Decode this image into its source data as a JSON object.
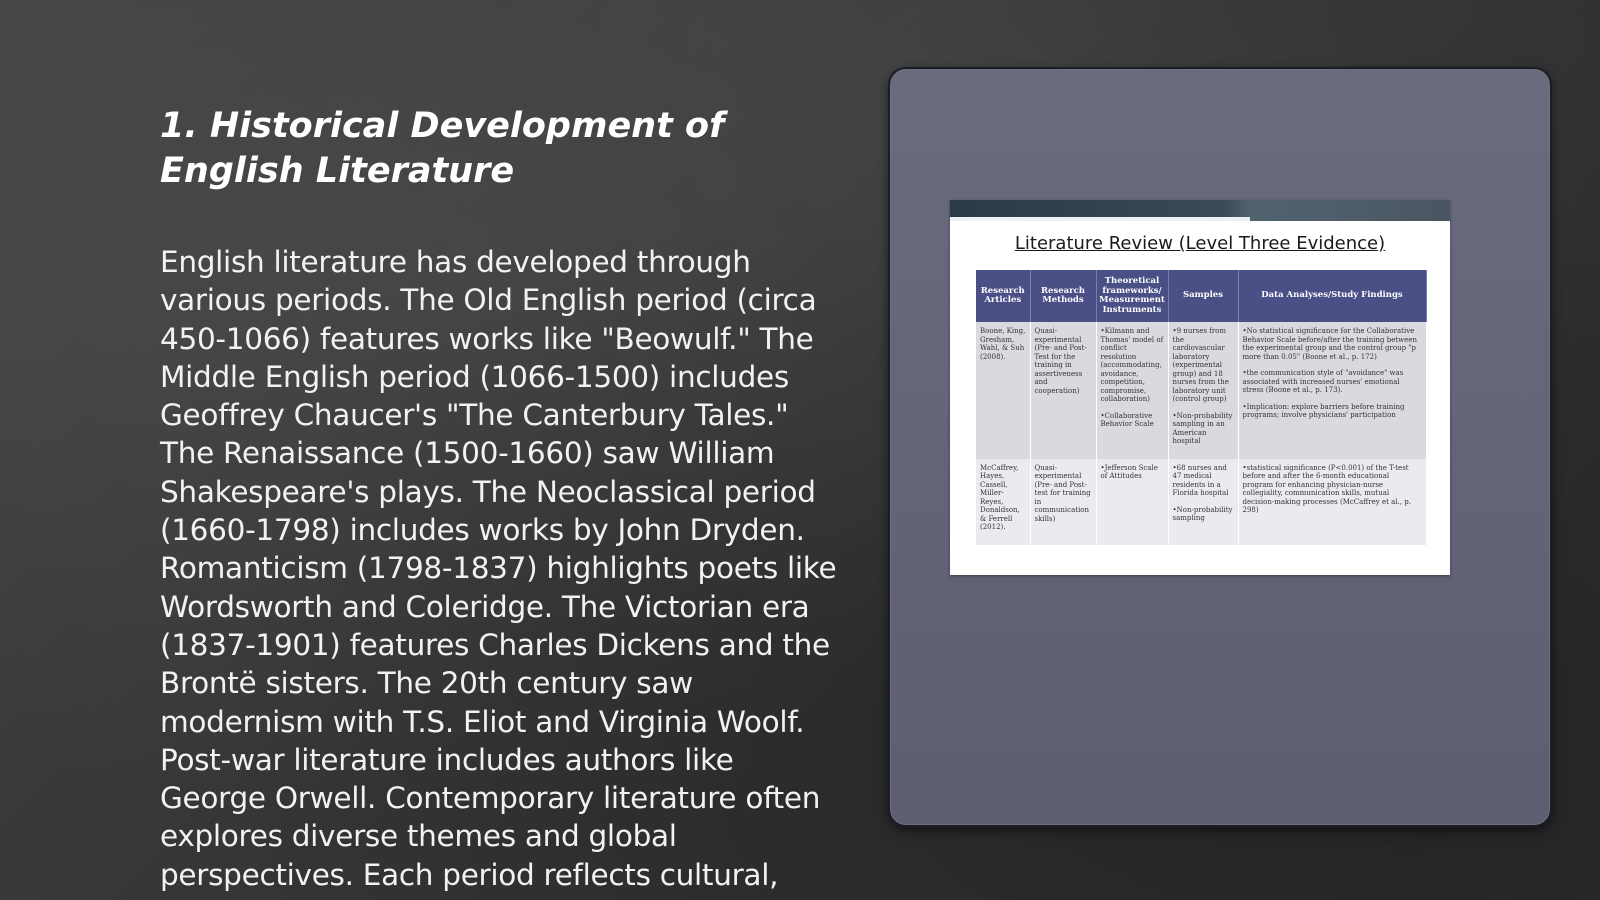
{
  "slide": {
    "title": "1. Historical Development of English Literature",
    "body": "English literature has developed through various periods. The Old English period (circa 450-1066) features works like \"Beowulf.\" The Middle English period (1066-1500) includes Geoffrey Chaucer's \"The Canterbury Tales.\" The Renaissance (1500-1660) saw William Shakespeare's plays. The Neoclassical period (1660-1798) includes works by John Dryden. Romanticism (1798-1837) highlights poets like Wordsworth and Coleridge. The Victorian era (1837-1901) features Charles Dickens and the Brontë sisters. The 20th century saw modernism with T.S. Eliot and Virginia Woolf. Post-war literature includes authors like George Orwell. Contemporary literature often explores diverse themes and global perspectives. Each period reflects cultural,"
  },
  "embedded_image": {
    "title": "Literature Review (Level Three Evidence)",
    "headers": [
      "Research Articles",
      "Research Methods",
      "Theoretical frameworks/ Measurement Instruments",
      "Samples",
      "Data Analyses/Study Findings"
    ],
    "rows": [
      {
        "articles": "Boone, King, Gresham, Wahl, & Suh (2008).",
        "methods": "Quasi-experimental (Pre- and Post-Test for the training in assertiveness and cooperation)",
        "frameworks": [
          "•Kilmann and Thomas' model of conflict resolution (accommodating, avoidance, competition, compromise, collaboration)",
          "•Collaborative Behavior Scale"
        ],
        "samples": [
          "•9 nurses from the cardiovascular laboratory (experimental group) and 18 nurses from the laboratory unit (control group)",
          "•Non-probability sampling in an American hospital"
        ],
        "findings": [
          "•No statistical significance for the Collaborative Behavior Scale before/after the training between the experimental group and the control group \"p more than 0.05\" (Boone et al., p. 172)",
          "•the communication style of \"avoidance\" was associated with increased nurses' emotional stress (Boone et al., p. 173).",
          "•Implication: explore barriers before training programs; involve physicians' participation"
        ]
      },
      {
        "articles": "McCaffrey, Hayes, Cassell, Miller-Reyes, Donaldson, & Ferrell (2012).",
        "methods": "Quasi-experimental (Pre- and Post-test for training in communication skills)",
        "frameworks": [
          "•Jefferson Scale of Attitudes"
        ],
        "samples": [
          "•68 nurses and 47 medical residents in a Florida hospital",
          "•Non-probability sampling"
        ],
        "findings": [
          "•statistical significance (P<0.001) of the T-test before and after the 6-month educational program for enhancing physician-nurse collegiality, communication skills, mutual decision-making processes (McCaffrey et al., p. 298)"
        ]
      }
    ]
  }
}
